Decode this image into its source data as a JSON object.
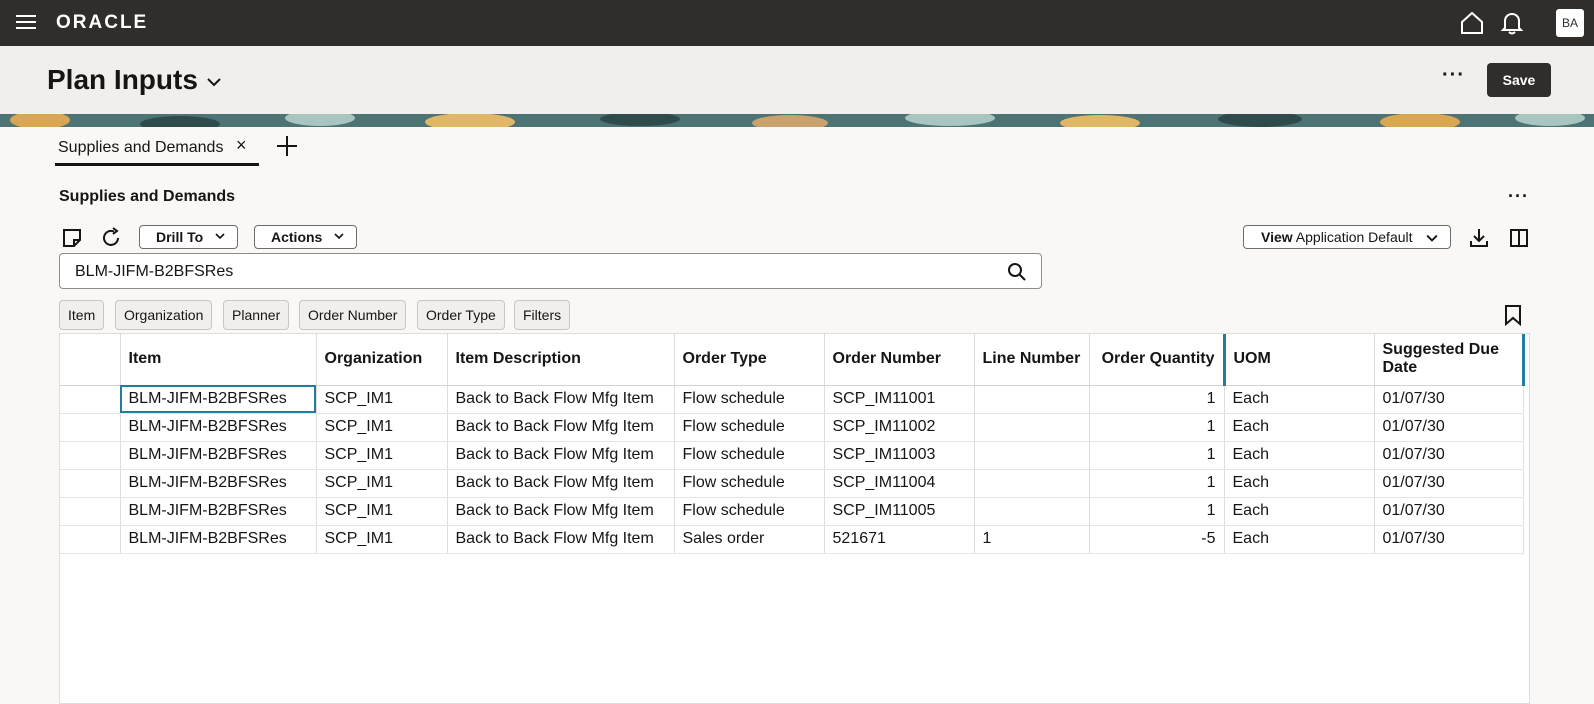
{
  "topbar": {
    "logo": "ORACLE",
    "avatar_initials": "BA"
  },
  "header": {
    "title": "Plan Inputs",
    "save_label": "Save",
    "more": "···"
  },
  "tabs": [
    {
      "label": "Supplies and Demands",
      "close": "×"
    }
  ],
  "section": {
    "title": "Supplies and Demands",
    "more": "···"
  },
  "toolbar": {
    "drill_to": "Drill To",
    "actions": "Actions",
    "view_prefix": "View",
    "view_value": "Application Default"
  },
  "search": {
    "value": "BLM-JIFM-B2BFSRes"
  },
  "chips": [
    "Item",
    "Organization",
    "Planner",
    "Order Number",
    "Order Type",
    "Filters"
  ],
  "table": {
    "columns": [
      "Item",
      "Organization",
      "Item Description",
      "Order Type",
      "Order Number",
      "Line Number",
      "Order Quantity",
      "UOM",
      "Suggested Due Date"
    ],
    "rows": [
      [
        "BLM-JIFM-B2BFSRes",
        "SCP_IM1",
        "Back to Back Flow Mfg Item",
        "Flow schedule",
        "SCP_IM11001",
        "",
        "1",
        "Each",
        "01/07/30"
      ],
      [
        "BLM-JIFM-B2BFSRes",
        "SCP_IM1",
        "Back to Back Flow Mfg Item",
        "Flow schedule",
        "SCP_IM11002",
        "",
        "1",
        "Each",
        "01/07/30"
      ],
      [
        "BLM-JIFM-B2BFSRes",
        "SCP_IM1",
        "Back to Back Flow Mfg Item",
        "Flow schedule",
        "SCP_IM11003",
        "",
        "1",
        "Each",
        "01/07/30"
      ],
      [
        "BLM-JIFM-B2BFSRes",
        "SCP_IM1",
        "Back to Back Flow Mfg Item",
        "Flow schedule",
        "SCP_IM11004",
        "",
        "1",
        "Each",
        "01/07/30"
      ],
      [
        "BLM-JIFM-B2BFSRes",
        "SCP_IM1",
        "Back to Back Flow Mfg Item",
        "Flow schedule",
        "SCP_IM11005",
        "",
        "1",
        "Each",
        "01/07/30"
      ],
      [
        "BLM-JIFM-B2BFSRes",
        "SCP_IM1",
        "Back to Back Flow Mfg Item",
        "Sales order",
        "521671",
        "1",
        "-5",
        "Each",
        "01/07/30"
      ]
    ]
  },
  "colors": {
    "topbar": "#312d2a",
    "accent": "#227e9e",
    "banner": "#5f8a8b"
  },
  "icons": [
    "hamburger-icon",
    "home-icon",
    "bell-icon",
    "chevron-down-icon",
    "close-icon",
    "plus-icon",
    "notes-icon",
    "refresh-icon",
    "download-icon",
    "column-layout-icon",
    "search-icon",
    "bookmark-icon"
  ]
}
